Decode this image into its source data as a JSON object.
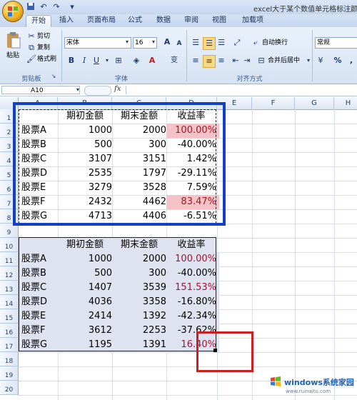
{
  "window": {
    "title": "excel大于某个数值单元格标注颜"
  },
  "tabs": [
    "开始",
    "插入",
    "页面布局",
    "公式",
    "数据",
    "审阅",
    "视图",
    "加载项"
  ],
  "ribbon": {
    "clipboard": {
      "paste": "粘贴",
      "cut": "剪切",
      "copy": "复制",
      "format_painter": "格式刷",
      "group_label": "剪贴板"
    },
    "font": {
      "font_name": "宋体",
      "font_size": "16",
      "grow": "A",
      "shrink": "A",
      "bold": "B",
      "italic": "I",
      "underline": "U",
      "font_color": "A",
      "phonetic": "变",
      "group_label": "字体"
    },
    "alignment": {
      "wrap_text": "自动换行",
      "merge_center": "合并后居中",
      "group_label": "对齐方式"
    },
    "number": {
      "format": "常规",
      "percent": "%",
      "comma": ","
    }
  },
  "formula_bar": {
    "name_box": "A10",
    "fx": "fx"
  },
  "columns": [
    "A",
    "B",
    "C",
    "D",
    "E",
    "F",
    "G",
    "H"
  ],
  "rows": [
    "1",
    "2",
    "3",
    "4",
    "5",
    "6",
    "7",
    "8",
    "9",
    "10",
    "11",
    "12",
    "13",
    "14",
    "15",
    "16",
    "17",
    "18",
    "19",
    "20"
  ],
  "table1": {
    "headers": [
      "",
      "期初金额",
      "期末金额",
      "收益率"
    ],
    "rows": [
      {
        "name": "股票A",
        "start": "1000",
        "end": "2000",
        "rate": "100.00%"
      },
      {
        "name": "股票B",
        "start": "500",
        "end": "300",
        "rate": "-40.00%"
      },
      {
        "name": "股票C",
        "start": "3107",
        "end": "3151",
        "rate": "1.42%"
      },
      {
        "name": "股票D",
        "start": "2535",
        "end": "1797",
        "rate": "-29.11%"
      },
      {
        "name": "股票E",
        "start": "3279",
        "end": "3528",
        "rate": "7.59%"
      },
      {
        "name": "股票F",
        "start": "2432",
        "end": "4462",
        "rate": "83.47%"
      },
      {
        "name": "股票G",
        "start": "4713",
        "end": "4406",
        "rate": "-6.51%"
      }
    ]
  },
  "table2": {
    "headers": [
      "",
      "期初金额",
      "期末金额",
      "收益率"
    ],
    "rows": [
      {
        "name": "股票A",
        "start": "1000",
        "end": "2000",
        "rate": "100.00%"
      },
      {
        "name": "股票B",
        "start": "500",
        "end": "300",
        "rate": "-40.00%"
      },
      {
        "name": "股票C",
        "start": "1407",
        "end": "3539",
        "rate": "151.53%"
      },
      {
        "name": "股票D",
        "start": "4036",
        "end": "3358",
        "rate": "-16.80%"
      },
      {
        "name": "股票E",
        "start": "2414",
        "end": "1392",
        "rate": "-42.34%"
      },
      {
        "name": "股票F",
        "start": "3612",
        "end": "2253",
        "rate": "-37.62%"
      },
      {
        "name": "股票G",
        "start": "1195",
        "end": "1391",
        "rate": "16.40%"
      }
    ]
  },
  "watermark": {
    "brand": "windows系统家园",
    "url": "www.ruinaitu.com"
  },
  "colors": {
    "highlight_pink": "#f4c2c7",
    "highlight_dark_pink": "#d9a7b5",
    "blue_annotation": "#1140c6",
    "red_annotation": "#cc1f1f"
  }
}
